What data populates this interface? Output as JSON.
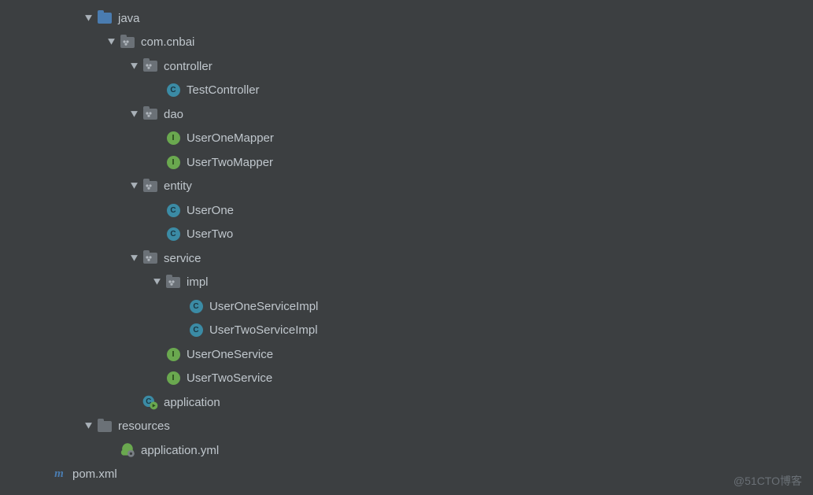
{
  "watermark": "@51CTO博客",
  "tree": [
    {
      "depth": 2,
      "arrow": true,
      "icon": "folder",
      "label": "java"
    },
    {
      "depth": 3,
      "arrow": true,
      "icon": "pkg",
      "label": "com.cnbai"
    },
    {
      "depth": 4,
      "arrow": true,
      "icon": "pkg",
      "label": "controller"
    },
    {
      "depth": 5,
      "arrow": false,
      "icon": "class",
      "label": "TestController"
    },
    {
      "depth": 4,
      "arrow": true,
      "icon": "pkg",
      "label": "dao"
    },
    {
      "depth": 5,
      "arrow": false,
      "icon": "interface",
      "label": "UserOneMapper"
    },
    {
      "depth": 5,
      "arrow": false,
      "icon": "interface",
      "label": "UserTwoMapper"
    },
    {
      "depth": 4,
      "arrow": true,
      "icon": "pkg",
      "label": "entity"
    },
    {
      "depth": 5,
      "arrow": false,
      "icon": "class",
      "label": "UserOne"
    },
    {
      "depth": 5,
      "arrow": false,
      "icon": "class",
      "label": "UserTwo"
    },
    {
      "depth": 4,
      "arrow": true,
      "icon": "pkg",
      "label": "service"
    },
    {
      "depth": 5,
      "arrow": true,
      "icon": "pkg",
      "label": "impl"
    },
    {
      "depth": 6,
      "arrow": false,
      "icon": "class",
      "label": "UserOneServiceImpl"
    },
    {
      "depth": 6,
      "arrow": false,
      "icon": "class",
      "label": "UserTwoServiceImpl"
    },
    {
      "depth": 5,
      "arrow": false,
      "icon": "interface",
      "label": "UserOneService"
    },
    {
      "depth": 5,
      "arrow": false,
      "icon": "interface",
      "label": "UserTwoService"
    },
    {
      "depth": 4,
      "arrow": false,
      "icon": "spring",
      "label": "application"
    },
    {
      "depth": 2,
      "arrow": true,
      "icon": "folder-grey",
      "label": "resources"
    },
    {
      "depth": 3,
      "arrow": false,
      "icon": "yml",
      "label": "application.yml"
    },
    {
      "depth": 0,
      "arrow": false,
      "icon": "maven",
      "label": "pom.xml"
    }
  ]
}
